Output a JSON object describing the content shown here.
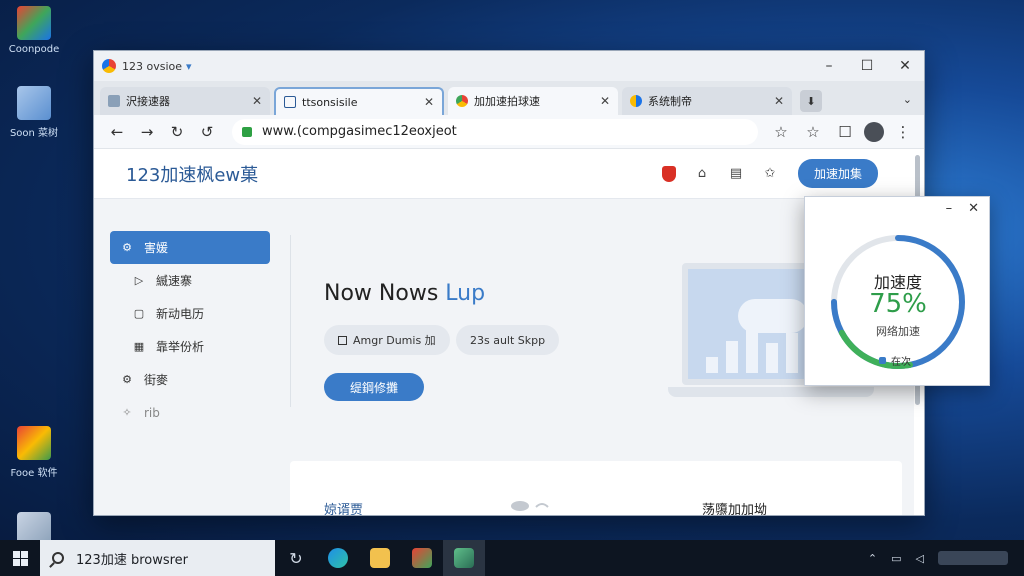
{
  "desktop": {
    "icons": [
      {
        "label": "Coonpode",
        "color": "#3fa65a"
      },
      {
        "label": "Soon 菜树",
        "color": "#5a8fd0"
      },
      {
        "label": "Fooe 软件",
        "color": "#3d9a4c"
      }
    ]
  },
  "taskbar": {
    "search_text": "123加速 browsrer"
  },
  "browser": {
    "window_title": "123 ovsioe",
    "tabs": [
      {
        "label": "沢接速器",
        "icon_color": "#8aa0b8"
      },
      {
        "label": "ttsonsisile",
        "icon_color": "#2b5a96"
      },
      {
        "label": "加加速拍球速",
        "icon_color": "#e94235"
      },
      {
        "label": "系统制帝",
        "icon_color": "#1a73e8"
      }
    ],
    "url": "www.(compgasimec12eoxjeot"
  },
  "page": {
    "site_title": "123加速枫ew菓",
    "header_button": "加速加集",
    "sidebar": [
      {
        "label": "害媛",
        "icon": "⚙"
      },
      {
        "label": "縅速寨",
        "icon": "▷"
      },
      {
        "label": "新动电历",
        "icon": "▢"
      },
      {
        "label": "靠举份析",
        "icon": "▦"
      },
      {
        "label": "街麥",
        "icon": "⚙"
      },
      {
        "label": "rib",
        "icon": "✧"
      }
    ],
    "hero_title_main": "Now Nows ",
    "hero_title_accent": "Lup",
    "chips": [
      "Amgr Dumis 加",
      "23s ault Skpp"
    ],
    "hero_button": "缇鋼修攤",
    "bottom_left": "婛谞贾",
    "bottom_right": "荡隳加加坳"
  },
  "widget": {
    "label": "加速度",
    "value": "75%",
    "percent": 0.75,
    "sub": "网络加速",
    "status": "在次"
  },
  "colors": {
    "accent": "#3a7bc8",
    "gauge_green": "#2e9d4a"
  }
}
